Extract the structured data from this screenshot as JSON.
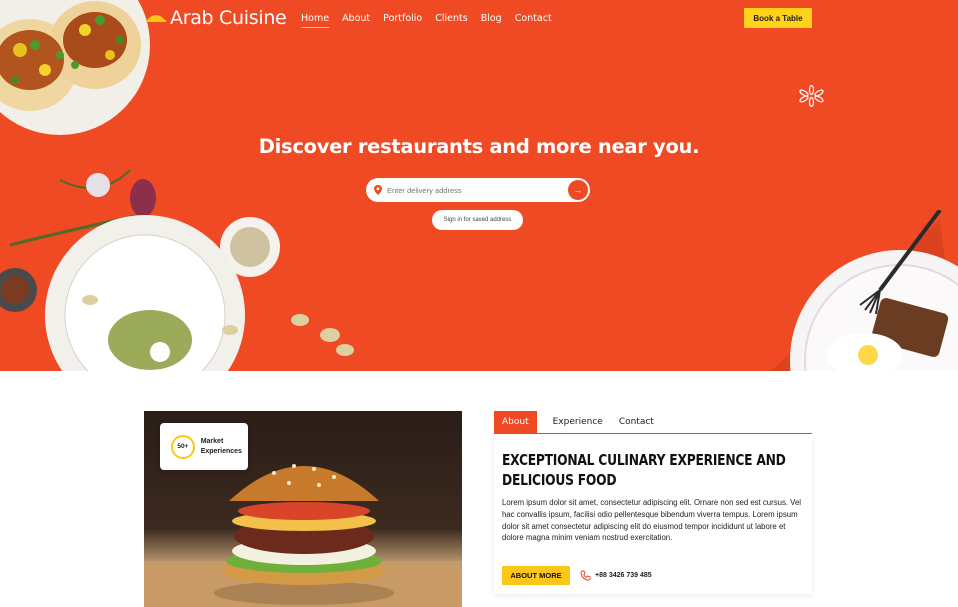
{
  "brand": {
    "name": "Arab Cuisine",
    "accent": "#f04a24",
    "highlight": "#ffd31a"
  },
  "nav": {
    "items": [
      {
        "label": "Home",
        "active": true
      },
      {
        "label": "About",
        "active": false
      },
      {
        "label": "Portfolio",
        "active": false
      },
      {
        "label": "Clients",
        "active": false
      },
      {
        "label": "Blog",
        "active": false
      },
      {
        "label": "Contact",
        "active": false
      }
    ],
    "cta_label": "Book a Table"
  },
  "hero": {
    "title": "Discover restaurants and more near you.",
    "address_placeholder": "Enter delivery address",
    "go_icon": "arrow-right-icon",
    "signin_label": "Sign in for saved address"
  },
  "feature": {
    "badge_value": "50+",
    "badge_label": "Market Experiences"
  },
  "tabs": [
    {
      "label": "About",
      "active": true
    },
    {
      "label": "Experience",
      "active": false
    },
    {
      "label": "Contact",
      "active": false
    }
  ],
  "about": {
    "title": "EXCEPTIONAL CULINARY EXPERIENCE AND DELICIOUS FOOD",
    "body": "Lorem ipsum dolor sit amet, consectetur adipiscing elit. Ornare non sed est cursus. Vel hac convallis ipsum, facilisi odio pellentesque bibendum viverra tempus. Lorem ipsum dolor sit amet consectetur adipiscing elit do eiusmod tempor incididunt ut labore et dolore magna minim veniam nostrud exercitation.",
    "button_label": "ABOUT MORE",
    "phone": "+88 3426 739 485"
  }
}
